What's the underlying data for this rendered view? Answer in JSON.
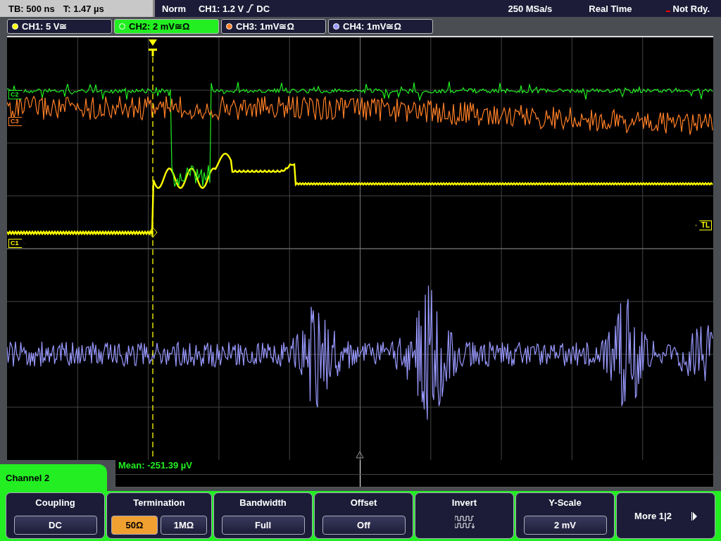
{
  "status_bar": {
    "timebase": "TB: 500 ns",
    "trigger_time": "T: 1.47 µs",
    "mode": "Norm",
    "trigger_level": "CH1: 1.2 V",
    "trigger_coupling": "DC",
    "sample_rate": "250 MSa/s",
    "acquisition": "Real Time",
    "state": "Not Rdy."
  },
  "channels": [
    {
      "label": "CH1: 5 V≅",
      "color": "#ffff00",
      "selected": false
    },
    {
      "label": "CH2: 2 mV≅Ω",
      "color": "#22ee22",
      "selected": true
    },
    {
      "label": "CH3: 1mV≅Ω",
      "color": "#ff7f27",
      "selected": false
    },
    {
      "label": "CH4: 1mV≅Ω",
      "color": "#9999ff",
      "selected": false
    }
  ],
  "trace_markers": [
    {
      "label": "C2",
      "color": "#22ee22"
    },
    {
      "label": "C3",
      "color": "#ff7f27"
    },
    {
      "label": "C1",
      "color": "#ffff00"
    }
  ],
  "trigger_level_marker": "TL",
  "measurement": "Mean: -251.39 µV",
  "menu": {
    "title": "Channel 2",
    "softkeys": [
      {
        "kind": "value",
        "label": "Coupling",
        "value": "DC"
      },
      {
        "kind": "choice",
        "label": "Termination",
        "options": [
          {
            "label": "50Ω",
            "selected": true
          },
          {
            "label": "1MΩ",
            "selected": false
          }
        ]
      },
      {
        "kind": "value",
        "label": "Bandwidth",
        "value": "Full"
      },
      {
        "kind": "value",
        "label": "Offset",
        "value": "Off"
      },
      {
        "kind": "icon",
        "label": "Invert"
      },
      {
        "kind": "value",
        "label": "Y-Scale",
        "value": "2 mV"
      },
      {
        "kind": "more",
        "label": "More 1|2"
      }
    ]
  }
}
